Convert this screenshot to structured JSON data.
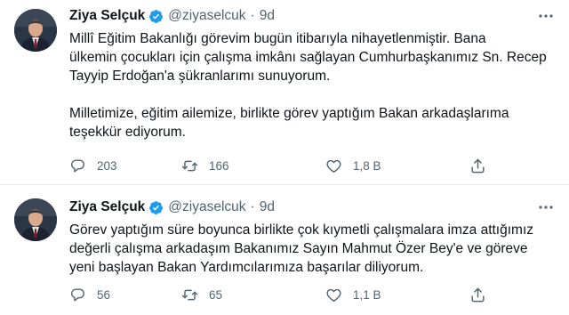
{
  "tweets": [
    {
      "name": "Ziya Selçuk",
      "handle": "@ziyaselcuk",
      "separator": "·",
      "time": "9d",
      "text_lines_1": [
        "Millî Eğitim Bakanlığı görevim bugün itibarıyla nihayetlenmiştir. Bana",
        "ülkemin çocukları için çalışma imkânı sağlayan Cumhurbaşkanımız Sn. Recep",
        "Tayyip Erdoğan'a şükranlarımı sunuyorum."
      ],
      "text_lines_2": [
        "Milletimize, eğitim ailemize, birlikte görev yaptığım Bakan arkadaşlarıma",
        "teşekkür ediyorum."
      ],
      "replies": "203",
      "retweets": "166",
      "likes": "1,8 B"
    },
    {
      "name": "Ziya Selçuk",
      "handle": "@ziyaselcuk",
      "separator": "·",
      "time": "9d",
      "text_lines_1": [
        "Görev yaptığım süre boyunca birlikte çok kıymetli çalışmalara imza attığımız",
        "değerli çalışma arkadaşım Bakanımız Sayın Mahmut Özer Bey'e ve göreve",
        "yeni başlayan Bakan Yardımcılarımıza  başarılar diliyorum."
      ],
      "replies": "56",
      "retweets": "65",
      "likes": "1,1 B"
    }
  ],
  "icons": {
    "verified": "verified-badge-icon",
    "reply": "reply-icon",
    "retweet": "retweet-icon",
    "like": "like-icon",
    "share": "share-icon",
    "more": "more-icon"
  },
  "colors": {
    "verified_badge": "#1d9bf0",
    "secondary_text": "#536471",
    "primary_text": "#0f1419",
    "divider": "#e3e8eb"
  }
}
